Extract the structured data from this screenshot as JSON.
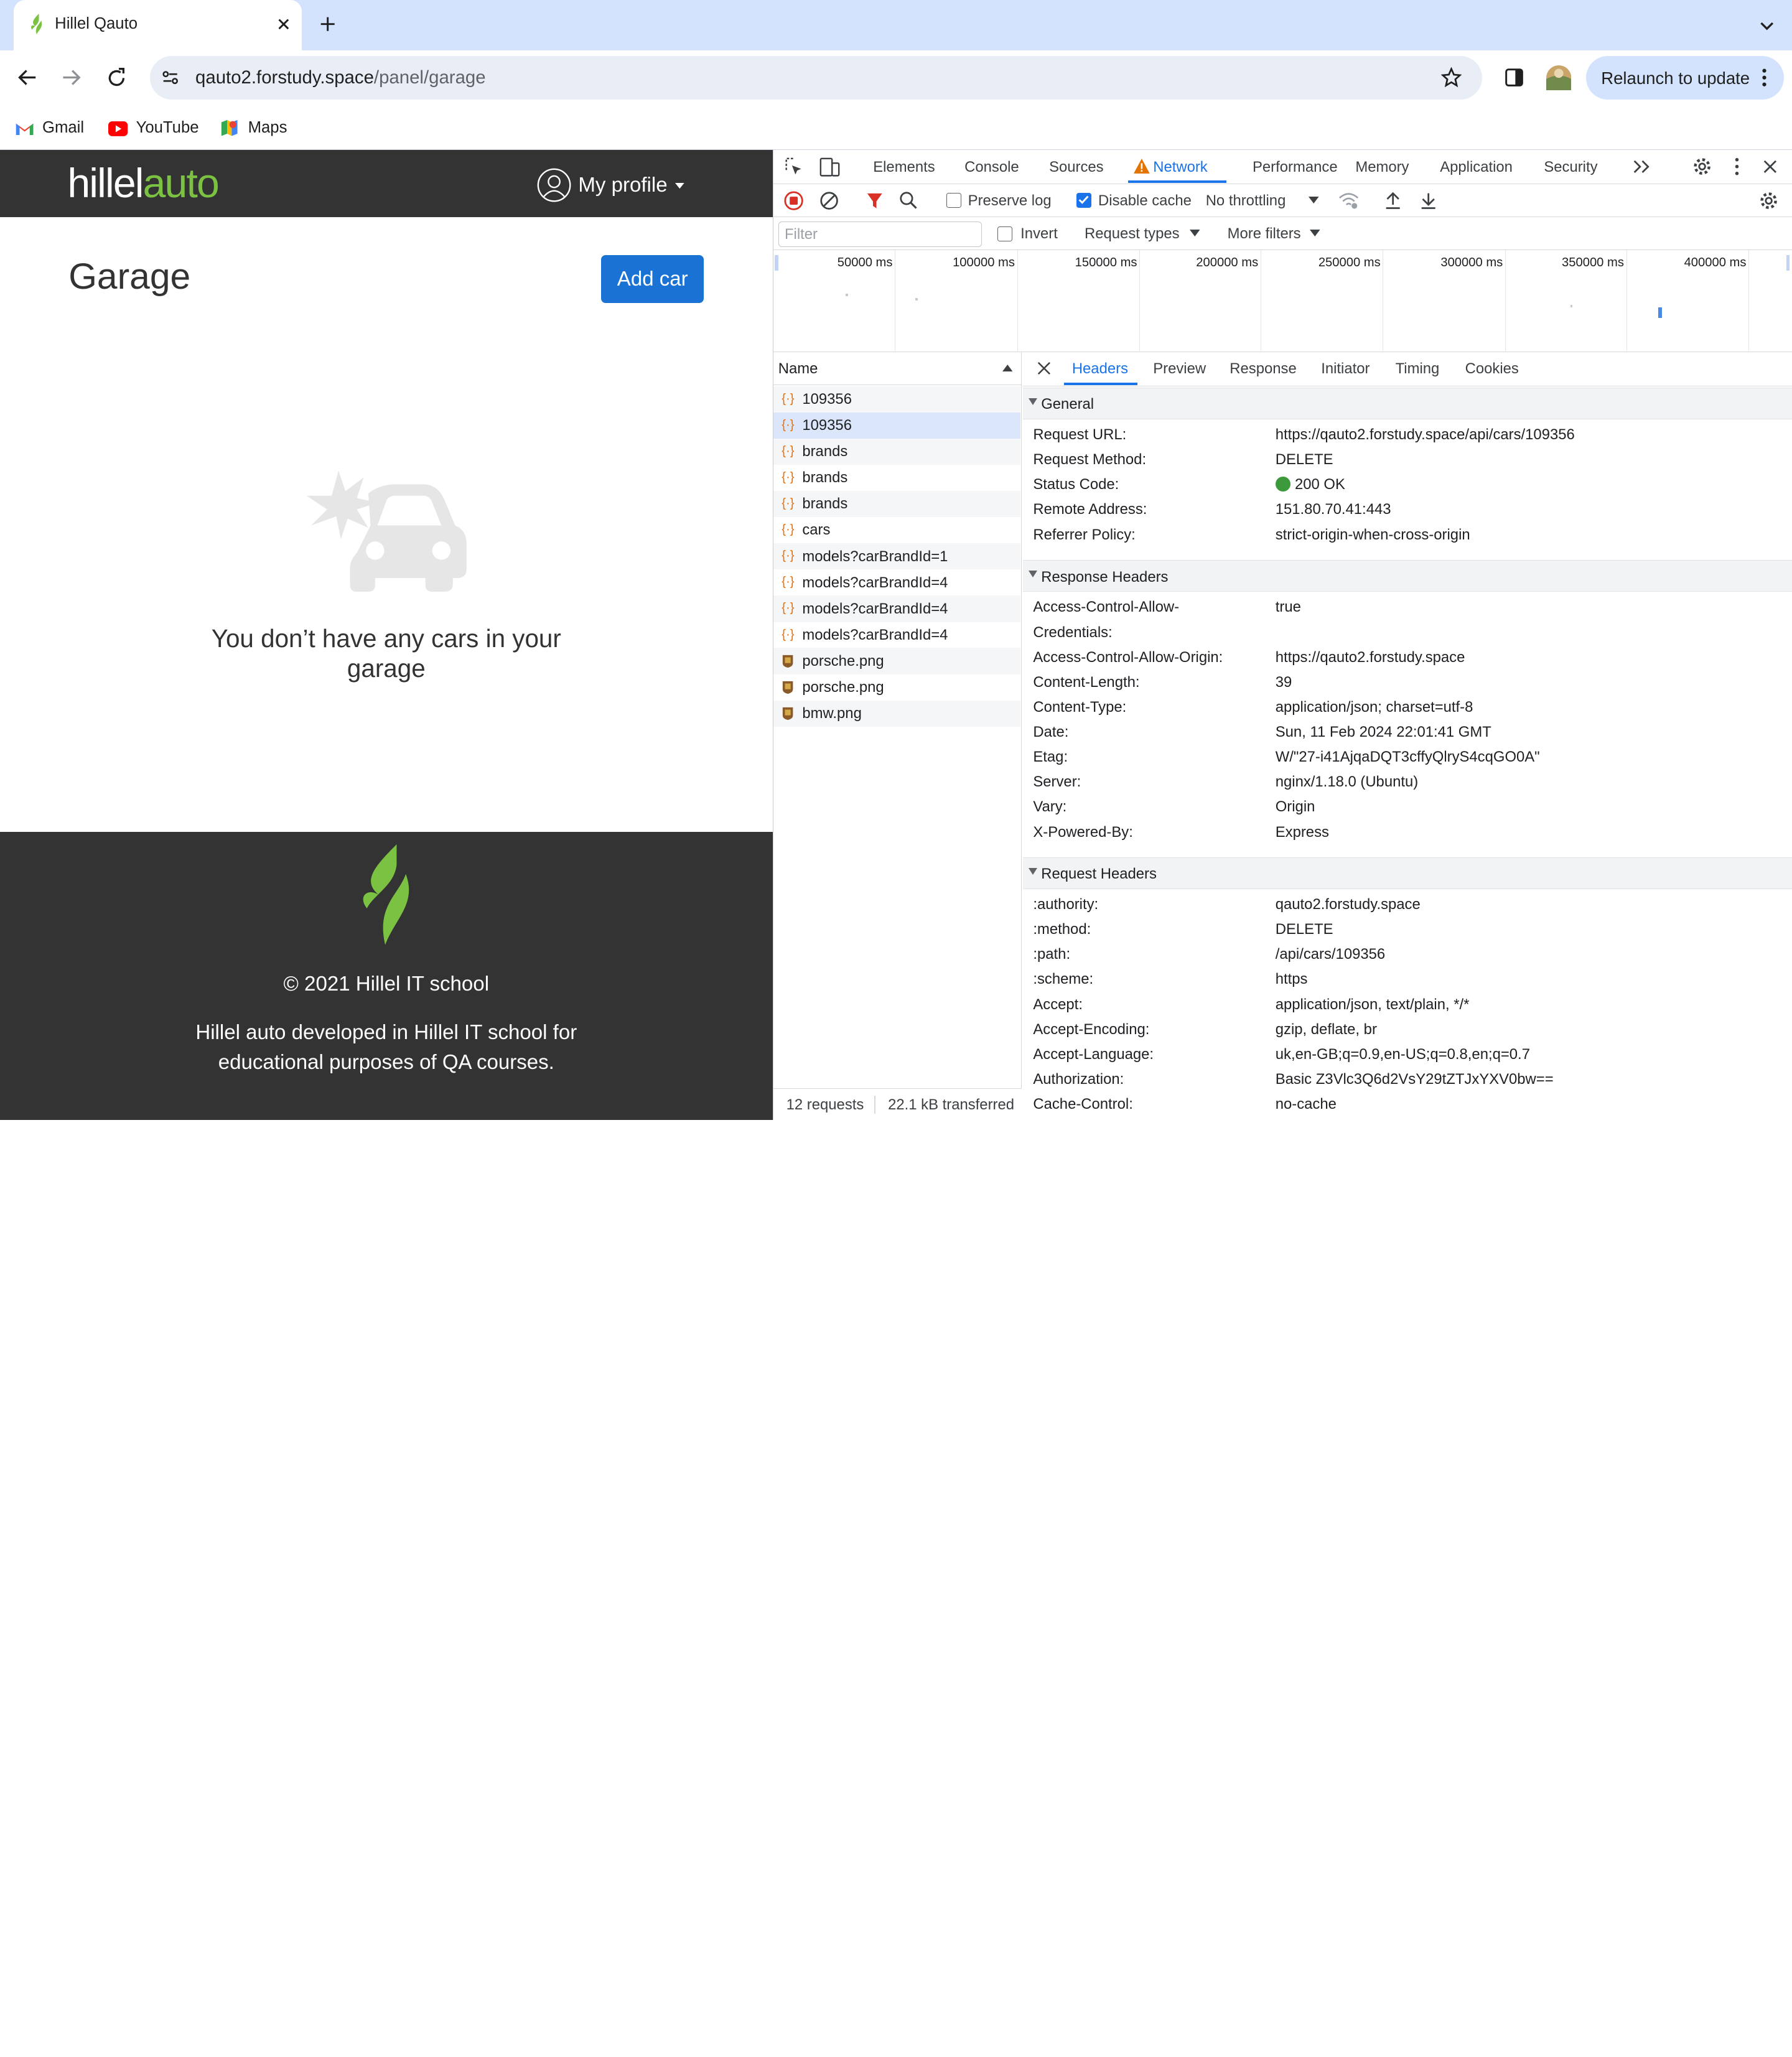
{
  "browser": {
    "tab_title": "Hillel Qauto",
    "url_host": "qauto2.forstudy.space",
    "url_path": "/panel/garage",
    "relaunch_label": "Relaunch to update",
    "bookmarks": [
      {
        "label": "Gmail"
      },
      {
        "label": "YouTube"
      },
      {
        "label": "Maps"
      }
    ]
  },
  "site": {
    "logo_part1": "hillel",
    "logo_part2": "auto",
    "profile_label": "My profile",
    "page_title": "Garage",
    "add_car_label": "Add car",
    "empty_message": "You don’t have any cars in your garage",
    "copyright": "© 2021 Hillel IT school",
    "footer_description": "Hillel auto developed in Hillel IT school for educational purposes of QA courses."
  },
  "devtools": {
    "tabs": [
      "Elements",
      "Console",
      "Sources",
      "Network",
      "Performance",
      "Memory",
      "Application",
      "Security"
    ],
    "active_tab": "Network",
    "preserve_log": "Preserve log",
    "disable_cache": "Disable cache",
    "throttling": "No throttling",
    "filter_placeholder": "Filter",
    "invert": "Invert",
    "request_types": "Request types",
    "more_filters": "More filters",
    "timeline_ticks": [
      "50000 ms",
      "100000 ms",
      "150000 ms",
      "200000 ms",
      "250000 ms",
      "300000 ms",
      "350000 ms",
      "400000 ms"
    ],
    "name_header": "Name",
    "requests": [
      {
        "name": "109356",
        "type": "fetch"
      },
      {
        "name": "109356",
        "type": "fetch"
      },
      {
        "name": "brands",
        "type": "fetch"
      },
      {
        "name": "brands",
        "type": "fetch"
      },
      {
        "name": "brands",
        "type": "fetch"
      },
      {
        "name": "cars",
        "type": "fetch"
      },
      {
        "name": "models?carBrandId=1",
        "type": "fetch"
      },
      {
        "name": "models?carBrandId=4",
        "type": "fetch"
      },
      {
        "name": "models?carBrandId=4",
        "type": "fetch"
      },
      {
        "name": "models?carBrandId=4",
        "type": "fetch"
      },
      {
        "name": "porsche.png",
        "type": "image"
      },
      {
        "name": "porsche.png",
        "type": "image"
      },
      {
        "name": "bmw.png",
        "type": "image"
      }
    ],
    "status_requests": "12 requests",
    "status_transferred": "22.1 kB transferred",
    "detail_tabs": [
      "Headers",
      "Preview",
      "Response",
      "Initiator",
      "Timing",
      "Cookies"
    ],
    "sections": {
      "general": "General",
      "response_headers": "Response Headers",
      "request_headers": "Request Headers"
    },
    "general": [
      {
        "k": "Request URL:",
        "v": "https://qauto2.forstudy.space/api/cars/109356"
      },
      {
        "k": "Request Method:",
        "v": "DELETE"
      },
      {
        "k": "Status Code:",
        "v": "200 OK"
      },
      {
        "k": "Remote Address:",
        "v": "151.80.70.41:443"
      },
      {
        "k": "Referrer Policy:",
        "v": "strict-origin-when-cross-origin"
      }
    ],
    "response_headers": [
      {
        "k": "Access-Control-Allow-",
        "k2": "Credentials:",
        "v": "true"
      },
      {
        "k": "Access-Control-Allow-Origin:",
        "v": "https://qauto2.forstudy.space"
      },
      {
        "k": "Content-Length:",
        "v": "39"
      },
      {
        "k": "Content-Type:",
        "v": "application/json; charset=utf-8"
      },
      {
        "k": "Date:",
        "v": "Sun, 11 Feb 2024 22:01:41 GMT"
      },
      {
        "k": "Etag:",
        "v": "W/\"27-i41AjqaDQT3cffyQlryS4cqGO0A\""
      },
      {
        "k": "Server:",
        "v": "nginx/1.18.0 (Ubuntu)"
      },
      {
        "k": "Vary:",
        "v": "Origin"
      },
      {
        "k": "X-Powered-By:",
        "v": "Express"
      }
    ],
    "request_headers": [
      {
        "k": ":authority:",
        "v": "qauto2.forstudy.space"
      },
      {
        "k": ":method:",
        "v": "DELETE"
      },
      {
        "k": ":path:",
        "v": "/api/cars/109356"
      },
      {
        "k": ":scheme:",
        "v": "https"
      },
      {
        "k": "Accept:",
        "v": "application/json, text/plain, */*"
      },
      {
        "k": "Accept-Encoding:",
        "v": "gzip, deflate, br"
      },
      {
        "k": "Accept-Language:",
        "v": "uk,en-GB;q=0.9,en-US;q=0.8,en;q=0.7"
      },
      {
        "k": "Authorization:",
        "v": "Basic Z3Vlc3Q6d2VsY29tZTJxYXV0bw=="
      },
      {
        "k": "Cache-Control:",
        "v": "no-cache"
      }
    ],
    "colors": {
      "accent": "#1a73e8",
      "status_ok": "#3c9a3c",
      "fetch_icon": "#e8710a"
    }
  }
}
